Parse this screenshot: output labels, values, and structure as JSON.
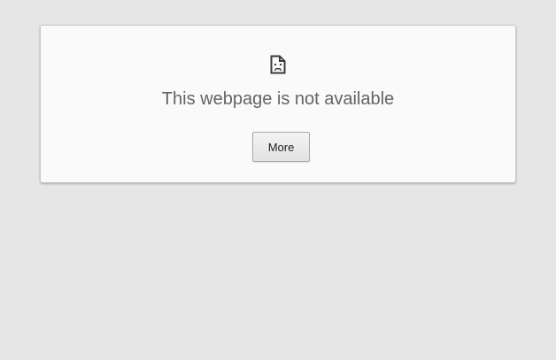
{
  "error": {
    "icon": "sad-page-icon",
    "title": "This webpage is not available",
    "more_label": "More"
  },
  "colors": {
    "background": "#e6e6e6",
    "card": "#fafafa",
    "title_text": "#646464"
  }
}
